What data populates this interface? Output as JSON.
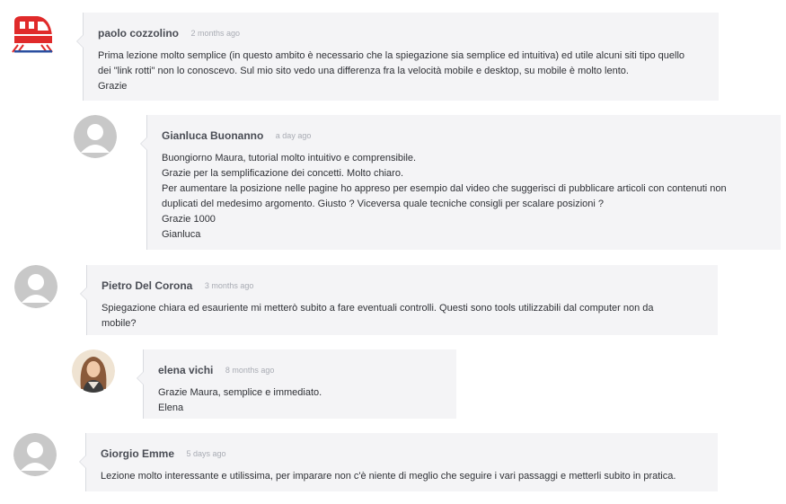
{
  "comments": [
    {
      "author": "paolo cozzolino",
      "time": "2 months ago",
      "lines": [
        "Prima lezione molto semplice (in questo ambito è necessario che la spiegazione sia semplice ed intuitiva) ed utile alcuni siti tipo quello",
        "dei \"link rotti\" non lo conoscevo.  Sul mio sito vedo una differenza fra la velocità mobile e desktop, su mobile è molto lento.",
        "Grazie"
      ]
    },
    {
      "author": "Gianluca Buonanno",
      "time": "a day ago",
      "lines": [
        "Buongiorno Maura, tutorial molto intuitivo e comprensibile.",
        "Grazie per la semplificazione dei concetti. Molto chiaro.",
        "Per aumentare la posizione nelle pagine ho appreso per esempio dal video che suggerisci di pubblicare articoli con contenuti non",
        "duplicati del medesimo argomento. Giusto ? Viceversa quale tecniche consigli per scalare posizioni ?",
        "Grazie 1000",
        "Gianluca"
      ]
    },
    {
      "author": "Pietro Del Corona",
      "time": "3 months ago",
      "lines": [
        "Spiegazione chiara ed esauriente mi metterò subito a fare eventuali  controlli. Questi sono tools utilizzabili dal computer non da",
        "mobile?"
      ]
    },
    {
      "author": "elena vichi",
      "time": "8 months ago",
      "lines": [
        "Grazie Maura, semplice e immediato.",
        "Elena"
      ]
    },
    {
      "author": "Giorgio Emme",
      "time": "5 days ago",
      "lines": [
        "Lezione molto interessante e utilissima, per imparare non c'è niente di meglio che seguire i vari passaggi e metterli subito in pratica."
      ]
    }
  ],
  "avatars": [
    {
      "kind": "train-logo",
      "color": "#e02a2a"
    },
    {
      "kind": "default-user",
      "color": "#c8c8c8"
    },
    {
      "kind": "default-user",
      "color": "#c8c8c8"
    },
    {
      "kind": "photo",
      "color": "#8a5a3a"
    },
    {
      "kind": "default-user",
      "color": "#c8c8c8"
    }
  ]
}
